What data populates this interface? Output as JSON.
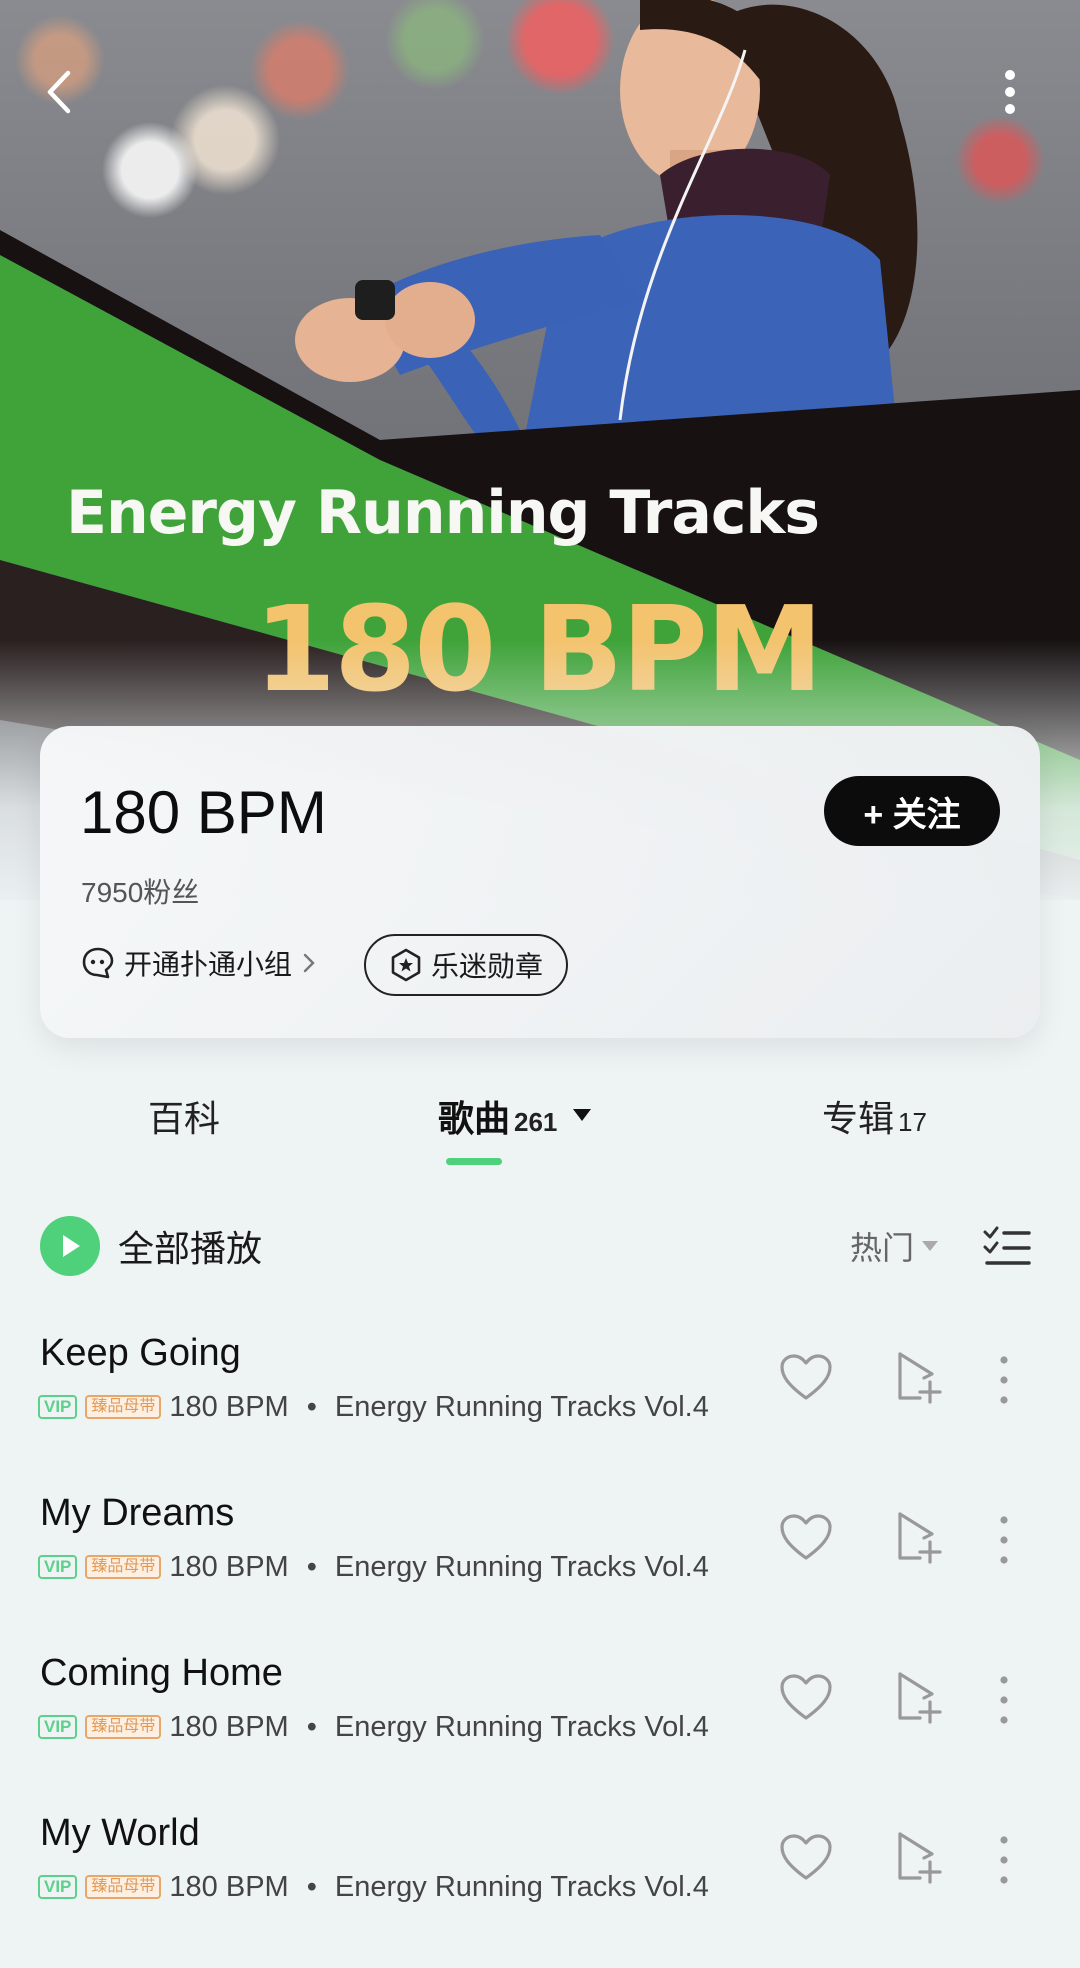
{
  "hero": {
    "title": "Energy Running Tracks",
    "subtitle": "180 BPM"
  },
  "nav": {
    "back_icon": "chevron-left-icon",
    "more_icon": "kebab-menu-icon"
  },
  "artist": {
    "name": "180 BPM",
    "fans": "7950粉丝",
    "follow_label": "+ 关注",
    "group_label": "开通扑通小组",
    "badge_label": "乐迷勋章"
  },
  "tabs": [
    {
      "label": "百科",
      "count": ""
    },
    {
      "label": "歌曲",
      "count": "261"
    },
    {
      "label": "专辑",
      "count": "17"
    }
  ],
  "playall": {
    "label": "全部播放",
    "sort_label": "热门"
  },
  "songs": [
    {
      "title": "Keep Going",
      "artist": "180 BPM",
      "album": "Energy Running Tracks Vol.4"
    },
    {
      "title": "My Dreams",
      "artist": "180 BPM",
      "album": "Energy Running Tracks Vol.4"
    },
    {
      "title": "Coming Home",
      "artist": "180 BPM",
      "album": "Energy Running Tracks Vol.4"
    },
    {
      "title": "My World",
      "artist": "180 BPM",
      "album": "Energy Running Tracks Vol.4"
    }
  ],
  "tags": {
    "vip": "VIP",
    "master": "臻品母带"
  },
  "colors": {
    "accent_green": "#4fd07a",
    "hero_bpm": "#f3c36e",
    "background": "#eef3f4"
  }
}
